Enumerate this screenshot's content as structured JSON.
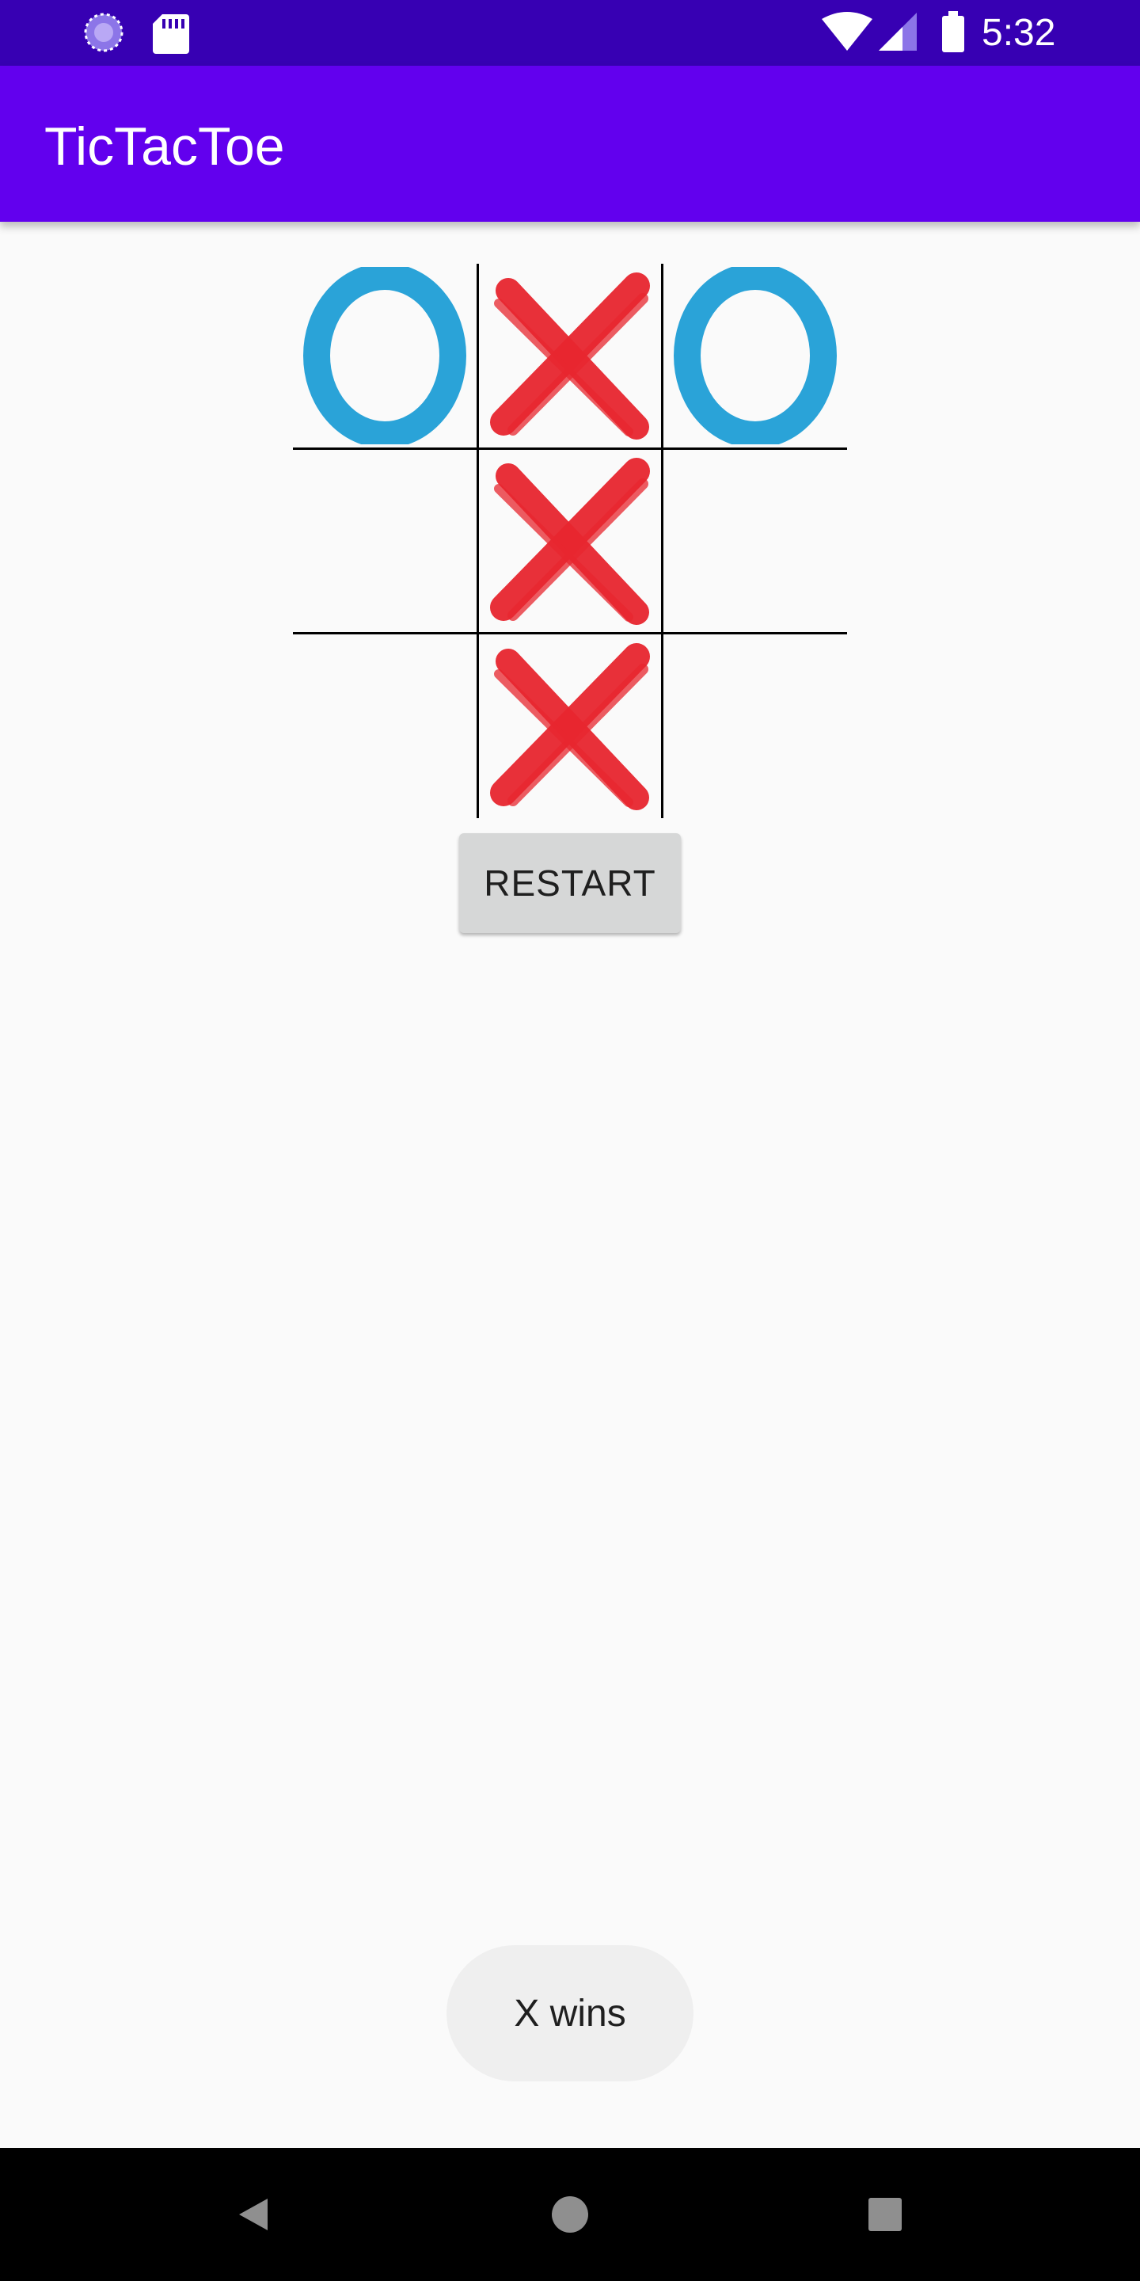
{
  "status_bar": {
    "time": "5:32",
    "icons_left": [
      "sync-icon",
      "sd-card-icon"
    ],
    "icons_right": [
      "wifi-icon",
      "cell-signal-icon",
      "battery-icon"
    ]
  },
  "app_bar": {
    "title": "TicTacToe",
    "color": "#6200ee",
    "status_color": "#3700b3"
  },
  "board": {
    "cells": [
      [
        "O",
        "X",
        "O"
      ],
      [
        "",
        "X",
        ""
      ],
      [
        "",
        "X",
        ""
      ]
    ],
    "x_color": "#e8262f",
    "o_color": "#2aa3d8"
  },
  "restart_label": "RESTART",
  "toast": {
    "text": "X wins"
  },
  "nav_bar": {
    "buttons": [
      "back-icon",
      "home-icon",
      "recents-icon"
    ]
  }
}
